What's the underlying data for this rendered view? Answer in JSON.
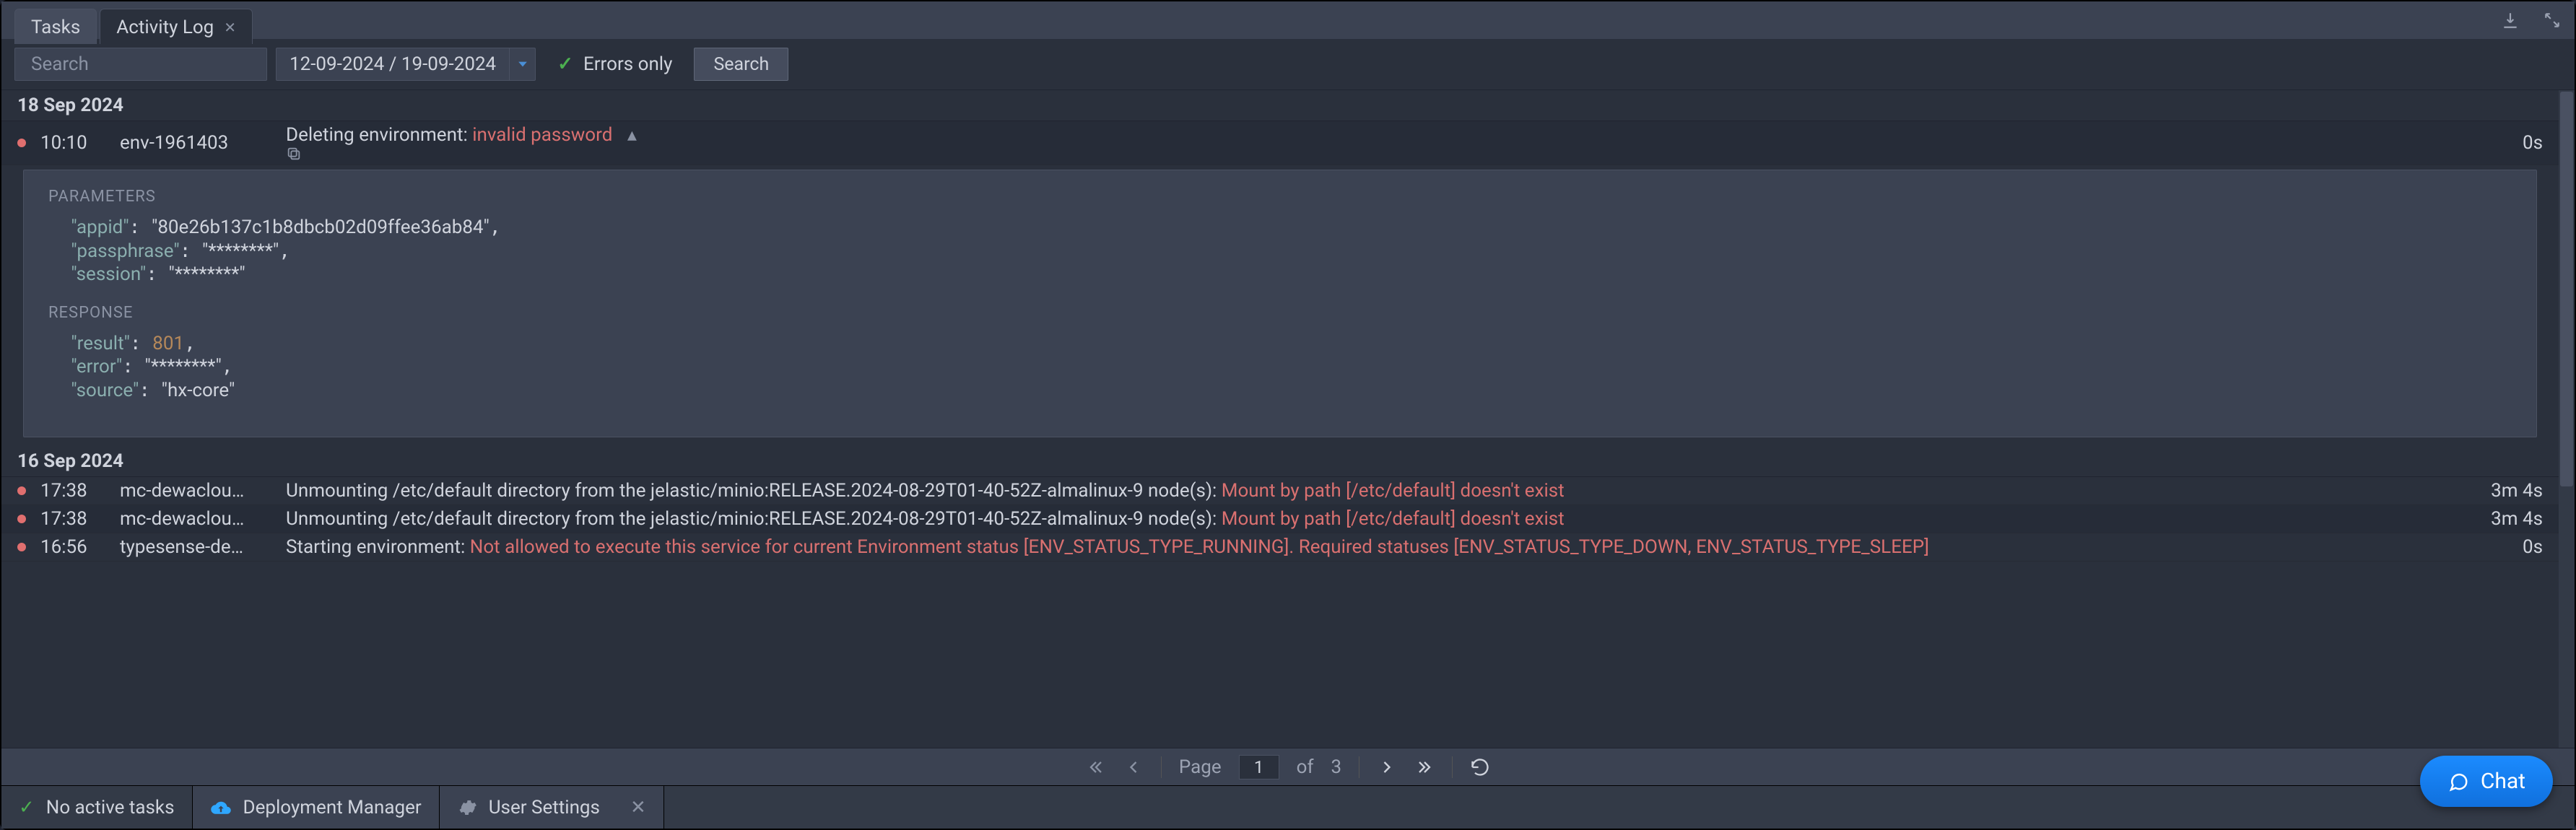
{
  "tabs": {
    "tasks": "Tasks",
    "activity": "Activity Log"
  },
  "toolbar": {
    "search_placeholder": "Search",
    "daterange": "12-09-2024 / 19-09-2024",
    "errors_label": "Errors only",
    "search_btn": "Search"
  },
  "groups": [
    {
      "date": "18 Sep 2024"
    },
    {
      "date": "16 Sep 2024"
    }
  ],
  "rows": {
    "r0": {
      "time": "10:10",
      "env": "env-1961403",
      "msg": "Deleting environment: ",
      "err": "invalid password",
      "dur": "0s"
    },
    "r1": {
      "time": "17:38",
      "env": "mc-dewaclou…",
      "msg": "Unmounting /etc/default directory from the jelastic/minio:RELEASE.2024-08-29T01-40-52Z-almalinux-9 node(s): ",
      "err": "Mount by path [/etc/default] doesn't exist",
      "dur": "3m 4s"
    },
    "r2": {
      "time": "17:38",
      "env": "mc-dewaclou…",
      "msg": "Unmounting /etc/default directory from the jelastic/minio:RELEASE.2024-08-29T01-40-52Z-almalinux-9 node(s): ",
      "err": "Mount by path [/etc/default] doesn't exist",
      "dur": "3m 4s"
    },
    "r3": {
      "time": "16:56",
      "env": "typesense-de…",
      "msg": "Starting environment: ",
      "err": "Not allowed to execute this service for current Environment status [ENV_STATUS_TYPE_RUNNING]. Required statuses [ENV_STATUS_TYPE_DOWN, ENV_STATUS_TYPE_SLEEP]",
      "dur": "0s"
    }
  },
  "expanded": {
    "params_h": "PARAMETERS",
    "resp_h": "RESPONSE",
    "params": {
      "appid": "80e26b137c1b8dbcb02d09ffee36ab84",
      "passphrase": "********",
      "session": "********"
    },
    "response": {
      "result": 801,
      "error": "********",
      "source": "hx-core"
    }
  },
  "pager": {
    "page_label": "Page",
    "page": "1",
    "of": "of",
    "total": "3"
  },
  "footer": {
    "tasks": "No active tasks",
    "deploy": "Deployment Manager",
    "settings": "User Settings"
  },
  "chat": "Chat"
}
